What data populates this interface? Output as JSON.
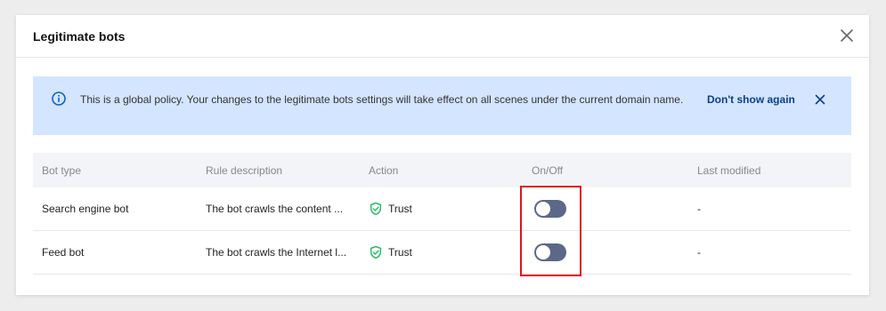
{
  "dialog": {
    "title": "Legitimate bots"
  },
  "notice": {
    "text": "This is a global policy. Your changes to the legitimate bots settings will take effect on all scenes under the current domain name.",
    "dismiss_label": "Don't show again",
    "background": "#d4e5ff",
    "accent": "#0b3f8c"
  },
  "table": {
    "headers": {
      "bot_type": "Bot type",
      "rule_description": "Rule description",
      "action": "Action",
      "on_off": "On/Off",
      "last_modified": "Last modified"
    },
    "rows": [
      {
        "bot_type": "Search engine bot",
        "rule_description": "The bot crawls the content ...",
        "action": "Trust",
        "enabled": false,
        "last_modified": "-"
      },
      {
        "bot_type": "Feed bot",
        "rule_description": "The bot crawls the Internet l...",
        "action": "Trust",
        "enabled": false,
        "last_modified": "-"
      }
    ]
  },
  "colors": {
    "toggle_off": "#5b6887",
    "trust_icon": "#2fb86b",
    "highlight": "#e0141e"
  }
}
